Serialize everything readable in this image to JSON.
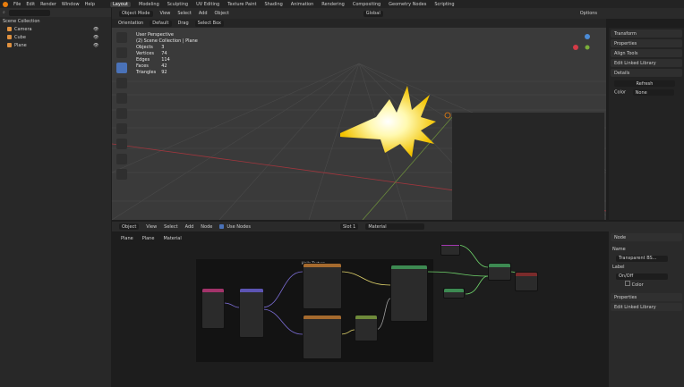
{
  "top_menu": [
    "File",
    "Edit",
    "Render",
    "Window",
    "Help"
  ],
  "workspace_tabs": [
    "Layout",
    "Modeling",
    "Sculpting",
    "UV Editing",
    "Texture Paint",
    "Shading",
    "Animation",
    "Rendering",
    "Compositing",
    "Geometry Nodes",
    "Scripting"
  ],
  "active_workspace": "Layout",
  "outliner": {
    "title": "Scene Collection",
    "items": [
      {
        "name": "Camera",
        "color": "#e0913f"
      },
      {
        "name": "Cube",
        "color": "#e0913f"
      },
      {
        "name": "Plane",
        "color": "#e0913f"
      }
    ]
  },
  "viewport_header": {
    "mode": "Object Mode",
    "menus": [
      "View",
      "Select",
      "Add",
      "Object"
    ],
    "transform": "Global",
    "options": "Options"
  },
  "viewport_header2": {
    "orientation": "Orientation",
    "default": "Default",
    "drag": "Drag",
    "select": "Select Box"
  },
  "viewport_info": {
    "line1": "User Perspective",
    "line2": "(2) Scene Collection | Plane",
    "stats": [
      {
        "label": "Objects",
        "value": "3"
      },
      {
        "label": "Vertices",
        "value": "74"
      },
      {
        "label": "Edges",
        "value": "114"
      },
      {
        "label": "Faces",
        "value": "42"
      },
      {
        "label": "Triangles",
        "value": "92"
      }
    ]
  },
  "n_panel": {
    "sections": [
      "Transform",
      "Properties",
      "Align Tools",
      "Edit Linked Library",
      "Details"
    ],
    "details_button": "Refresh",
    "color_label": "Color",
    "color_value": "None"
  },
  "node_editor_header": {
    "editor": "Object",
    "menus": [
      "View",
      "Select",
      "Add",
      "Node"
    ],
    "use_nodes": "Use Nodes",
    "slot": "Slot 1",
    "material": "Material"
  },
  "breadcrumb": [
    "Plane",
    "Plane",
    "Material"
  ],
  "node_frame_title": "Hello Texture",
  "node_side_panel": {
    "title": "Node",
    "name_label": "Name",
    "name_value": "Transparent BS...",
    "label_label": "Label",
    "label_value": "On/Off",
    "color": "Color",
    "properties": "Properties",
    "library": "Edit Linked Library"
  }
}
